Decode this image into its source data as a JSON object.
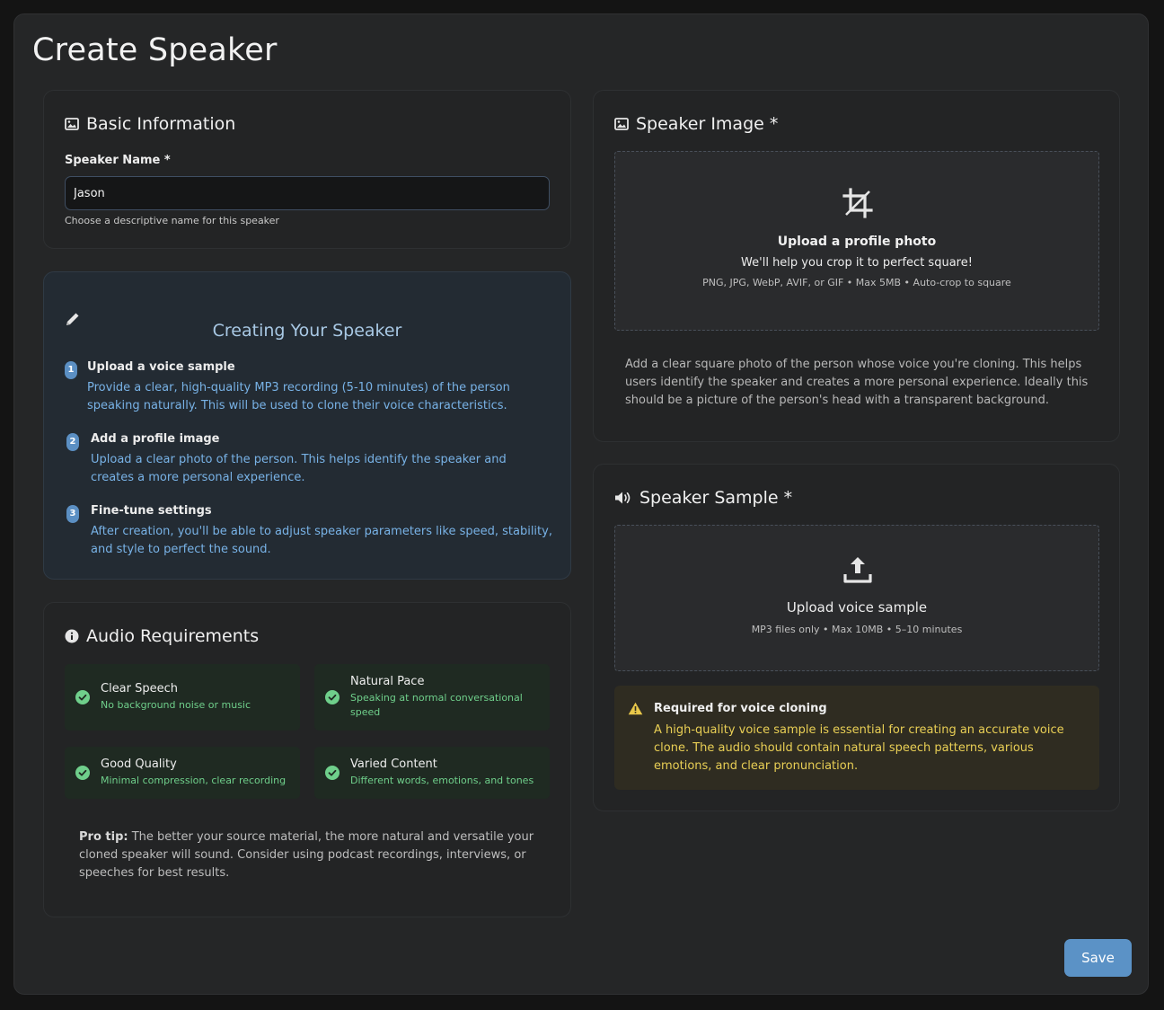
{
  "page": {
    "title": "Create Speaker"
  },
  "basic": {
    "title": "Basic Information",
    "name_label": "Speaker Name *",
    "name_value": "Jason",
    "name_hint": "Choose a descriptive name for this speaker"
  },
  "guide": {
    "title": "Creating Your Speaker",
    "steps": [
      {
        "num": "1",
        "title": "Upload a voice sample",
        "desc": "Provide a clear, high-quality MP3 recording (5-10 minutes) of the person speaking naturally. This will be used to clone their voice characteristics."
      },
      {
        "num": "2",
        "title": "Add a profile image",
        "desc": "Upload a clear photo of the person. This helps identify the speaker and creates a more personal experience."
      },
      {
        "num": "3",
        "title": "Fine-tune settings",
        "desc": "After creation, you'll be able to adjust speaker parameters like speed, stability, and style to perfect the sound."
      }
    ]
  },
  "audio": {
    "title": "Audio Requirements",
    "items": [
      {
        "title": "Clear Speech",
        "desc": "No background noise or music"
      },
      {
        "title": "Natural Pace",
        "desc": "Speaking at normal conversational speed"
      },
      {
        "title": "Good Quality",
        "desc": "Minimal compression, clear recording"
      },
      {
        "title": "Varied Content",
        "desc": "Different words, emotions, and tones"
      }
    ],
    "pro_tip_label": "Pro tip:",
    "pro_tip_text": " The better your source material, the more natural and versatile your cloned speaker will sound. Consider using podcast recordings, interviews, or speeches for best results."
  },
  "image": {
    "title": "Speaker Image *",
    "upload_title": "Upload a profile photo",
    "upload_sub": "We'll help you crop it to perfect square!",
    "upload_meta": "PNG, JPG, WebP, AVIF, or GIF • Max 5MB • Auto-crop to square",
    "helper": "Add a clear square photo of the person whose voice you're cloning. This helps users identify the speaker and creates a more personal experience. Ideally this should be a picture of the person's head with a transparent background."
  },
  "sample": {
    "title": "Speaker Sample *",
    "upload_title": "Upload voice sample",
    "upload_meta": "MP3 files only • Max 10MB • 5–10 minutes",
    "warning_title": "Required for voice cloning",
    "warning_desc": "A high-quality voice sample is essential for creating an accurate voice clone. The audio should contain natural speech patterns, various emotions, and clear pronunciation."
  },
  "actions": {
    "save": "Save"
  },
  "icons": {
    "basic": "image-icon",
    "guide": "pencil-icon",
    "audio": "info-circle-icon",
    "image": "image-icon",
    "crop": "crop-icon",
    "sample": "volume-icon",
    "upload": "upload-icon",
    "warning": "warning-triangle-icon",
    "check": "check-circle-icon"
  },
  "colors": {
    "accent": "#5b92c6",
    "success": "#6fcf8b",
    "warning": "#e9cf55",
    "guide_text": "#78b2e6"
  }
}
